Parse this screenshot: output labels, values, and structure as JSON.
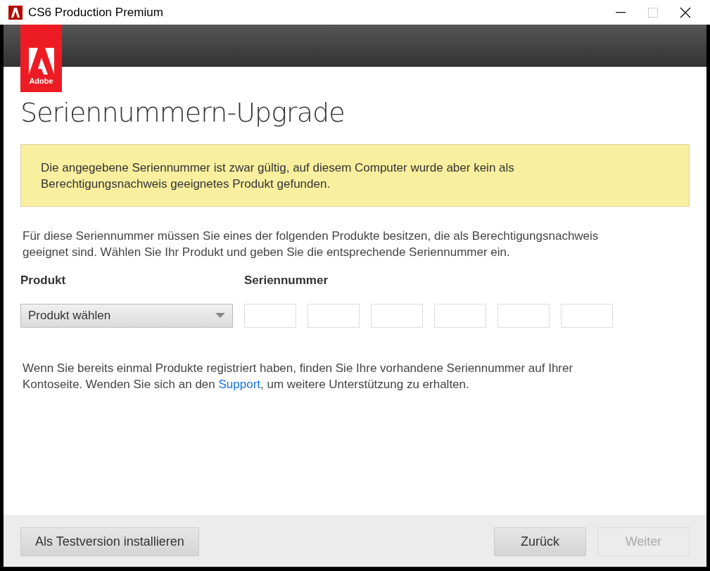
{
  "window": {
    "title": "CS6 Production Premium"
  },
  "logo": {
    "text": "Adobe"
  },
  "heading": "Seriennummern-Upgrade",
  "notice": "Die angegebene Seriennummer ist zwar gültig, auf diesem Computer wurde aber kein als Berechtigungsnachweis geeignetes Produkt gefunden.",
  "intro": "Für diese Seriennummer müssen Sie eines der folgenden Produkte besitzen, die als Berechtigungsnachweis geeignet sind. Wählen Sie Ihr Produkt und geben Sie die entsprechende Seriennummer ein.",
  "product": {
    "label": "Produkt",
    "value": "Produkt wählen"
  },
  "serial": {
    "label": "Seriennummer",
    "fields": [
      {
        "kind": "input"
      },
      {
        "kind": "input"
      },
      {
        "kind": "input"
      },
      {
        "kind": "input"
      },
      {
        "kind": "input"
      },
      {
        "kind": "input"
      }
    ]
  },
  "help": {
    "before": "Wenn Sie bereits einmal Produkte registriert haben, finden Sie Ihre vorhandene Seriennummer auf Ihrer Kontoseite. Wenden Sie sich an den ",
    "link": "Support",
    "after": ", um weitere Unterstützung zu erhalten."
  },
  "buttons": [
    {
      "label": "Als Testversion installieren",
      "disabled": false
    },
    {
      "label": "Zurück",
      "disabled": false
    },
    {
      "label": "Weiter",
      "disabled": true
    }
  ]
}
